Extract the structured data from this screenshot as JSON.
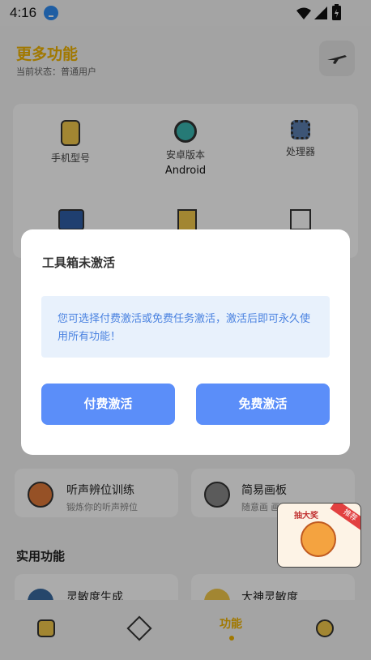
{
  "status_bar": {
    "time": "4:16",
    "icons": [
      "download-icon",
      "wifi-icon",
      "signal-icon",
      "battery-icon"
    ]
  },
  "header": {
    "title": "更多功能",
    "subtitle": "当前状态：普通用户"
  },
  "device_info": [
    {
      "label": "手机型号",
      "value": "",
      "icon": "phone-icon"
    },
    {
      "label": "安卓版本",
      "value": "Android",
      "icon": "android-icon"
    },
    {
      "label": "处理器",
      "value": "",
      "icon": "cpu-icon"
    }
  ],
  "features": [
    {
      "title": "听声辨位训练",
      "desc": "锻炼你的听声辨位",
      "icon": "headset-avatar-icon"
    },
    {
      "title": "简易画板",
      "desc": "随意画 画画",
      "icon": "palette-icon"
    }
  ],
  "sections": {
    "practical": "实用功能"
  },
  "practical_items": [
    {
      "title": "灵敏度生成"
    },
    {
      "title": "大神灵敏度"
    }
  ],
  "tabbar": {
    "items": [
      {
        "label": "",
        "icon": "home-icon"
      },
      {
        "label": "",
        "icon": "box-icon"
      },
      {
        "label": "功能",
        "icon": ""
      },
      {
        "label": "",
        "icon": "profile-icon"
      }
    ],
    "active_color": "#f0b400"
  },
  "dialog": {
    "title": "工具箱未激活",
    "message": "您可选择付费激活或免费任务激活，激活后即可永久使用所有功能！",
    "paid_button": "付费激活",
    "free_button": "免费激活"
  },
  "promo": {
    "title": "抽大奖",
    "tag": "推荐"
  },
  "colors": {
    "accent": "#f0b400",
    "button": "#5b8ef9",
    "message_bg": "#e8f1fc",
    "message_text": "#4a82e0"
  }
}
